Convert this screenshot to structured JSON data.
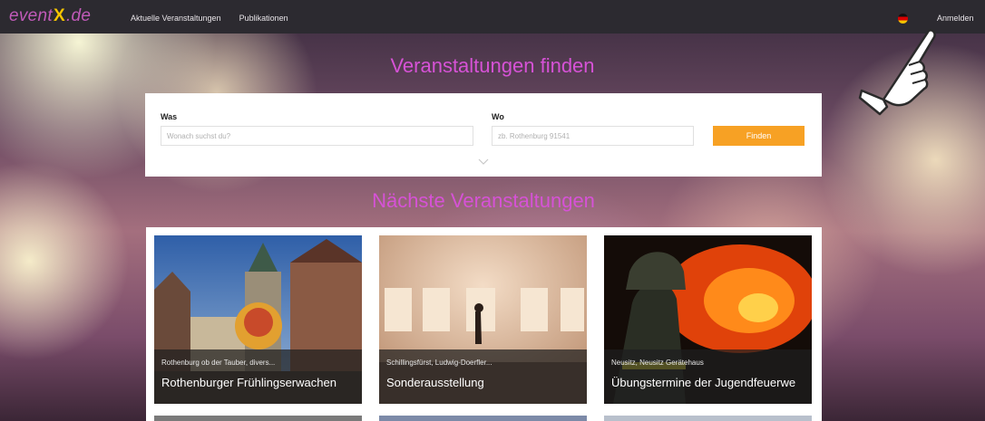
{
  "header": {
    "logo": {
      "prefix": "event",
      "x": "X",
      "suffix": ".de"
    },
    "nav": [
      "Aktuelle Veranstaltungen",
      "Publikationen"
    ],
    "language_flag": "flag-de-icon",
    "login_label": "Anmelden"
  },
  "hero": {
    "title": "Veranstaltungen finden"
  },
  "search": {
    "what_label": "Was",
    "what_placeholder": "Wonach suchst du?",
    "where_label": "Wo",
    "where_placeholder": "zb. Rothenburg 91541",
    "submit_label": "Finden",
    "expand_icon": "chevron-down-icon"
  },
  "upcoming": {
    "title": "Nächste Veranstaltungen",
    "events": [
      {
        "location": "Rothenburg ob der Tauber, divers...",
        "title": "Rothenburger Frühlingserwachen"
      },
      {
        "location": "Schillingsfürst, Ludwig-Doerfler...",
        "title": "Sonderausstellung"
      },
      {
        "location": "Neusitz, Neusitz Gerätehaus",
        "title": "Übungstermine der Jugendfeuerwe"
      }
    ]
  },
  "colors": {
    "accent": "#d652d6",
    "button": "#f7a124",
    "topbar": "#2c2a30"
  }
}
